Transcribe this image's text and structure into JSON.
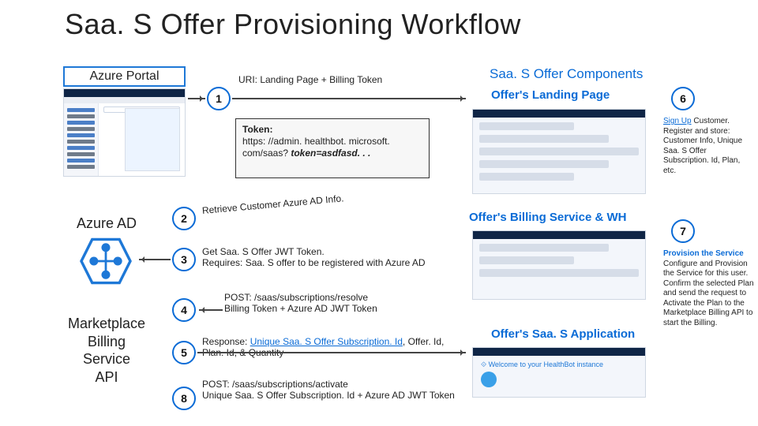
{
  "title": "Saa. S Offer Provisioning Workflow",
  "left": {
    "azure_portal": "Azure Portal",
    "azure_ad": "Azure AD",
    "marketplace": "Marketplace\nBilling\nService\nAPI"
  },
  "center": {
    "uri_label": "URI: Landing Page + Billing Token",
    "callout_title": "Token:",
    "callout_url": "https: //admin. healthbot. microsoft. com/saas? ",
    "callout_q": "token=asdfasd. . .",
    "retrieve": "Retrieve Customer Azure AD Info.",
    "jwt1": "Get Saa. S Offer JWT Token.",
    "jwt2": "Requires: Saa. S offer to be registered with Azure AD",
    "post_resolve_l1": "POST: /saas/subscriptions/resolve",
    "post_resolve_l2": "Billing Token + Azure AD JWT Token",
    "response_l1": "Response: ",
    "response_link": "Unique Saa. S Offer Subscription. Id",
    "response_l2": ", Offer. Id, Plan. Id, & Quantity",
    "post_activate_l1": "POST: /saas/subscriptions/activate",
    "post_activate_l2": "Unique Saa. S Offer Subscription. Id + Azure AD JWT Token"
  },
  "right": {
    "components": "Saa. S Offer Components",
    "landing": "Offer's Landing Page",
    "billing": "Offer's Billing Service & WH",
    "app": "Offer's Saa. S Application"
  },
  "notes": {
    "n6_link": "Sign Up",
    "n6_rest": " Customer. Register and store: Customer Info, Unique Saa. S Offer Subscription. Id, Plan, etc.",
    "n7_title": "Provision the Service",
    "n7_body": "Configure and Provision the Service for this user. Confirm the selected Plan and send the request to Activate the Plan to the Marketplace Billing API to start the Billing."
  },
  "bubbles": {
    "b1": "1",
    "b2": "2",
    "b3": "3",
    "b4": "4",
    "b5": "5",
    "b6": "6",
    "b7": "7",
    "b8": "8"
  }
}
